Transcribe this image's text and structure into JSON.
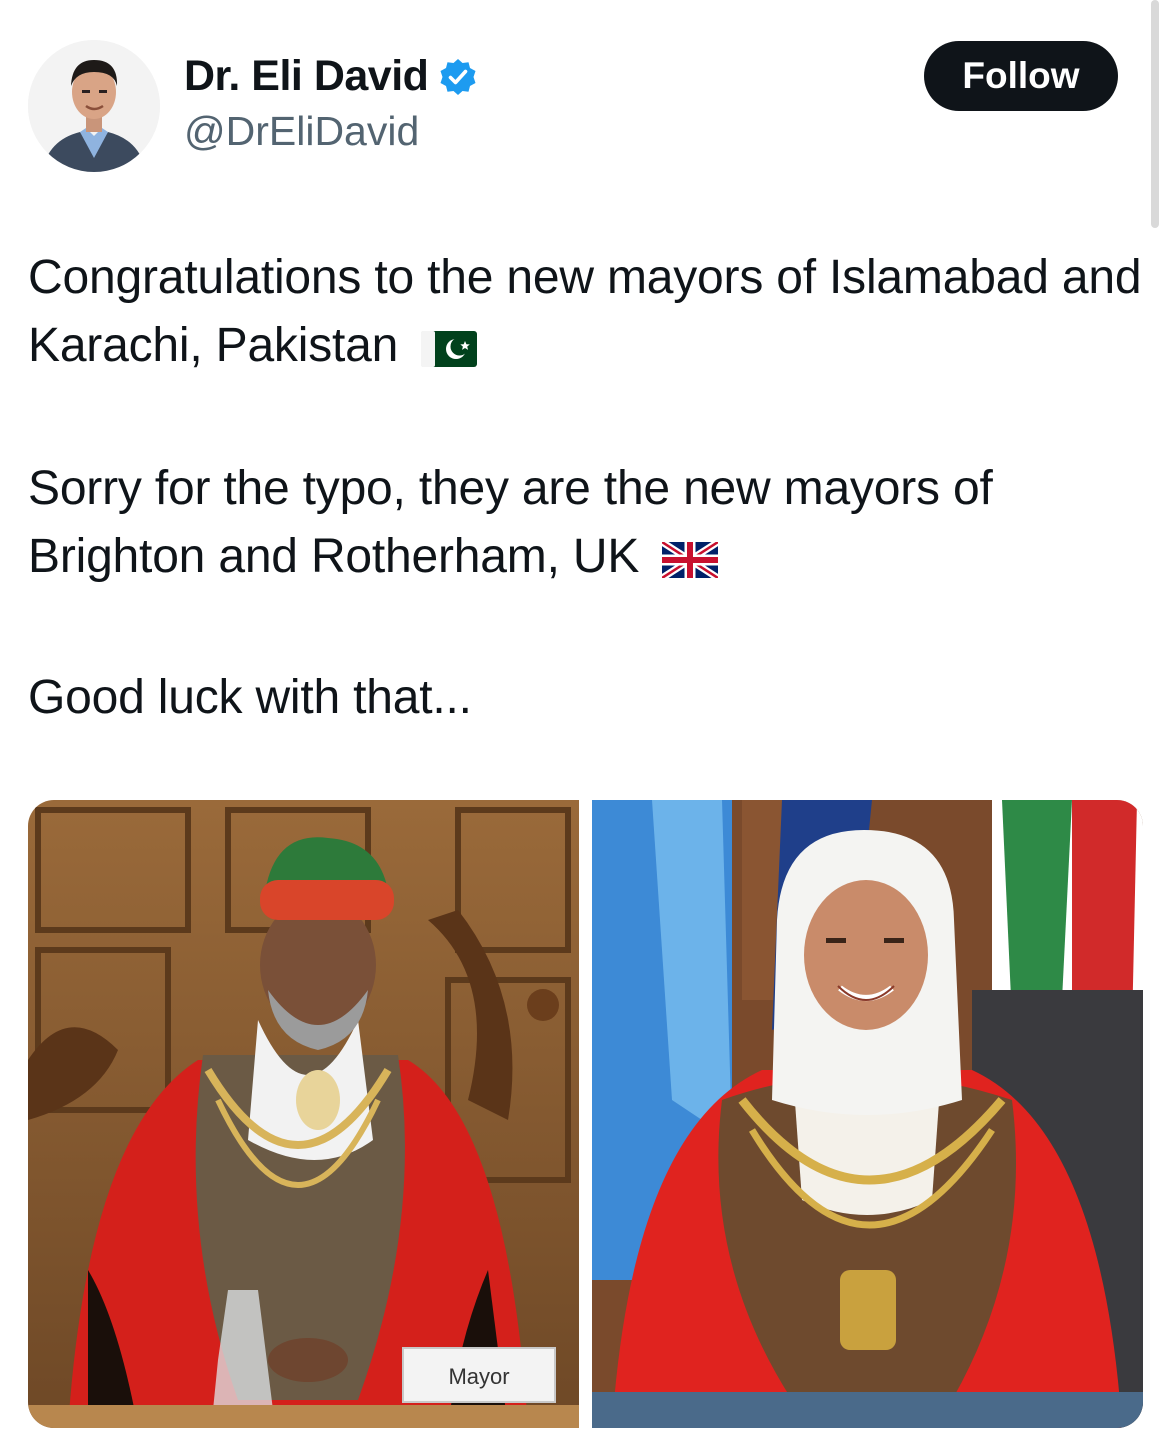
{
  "author": {
    "name": "Dr. Eli David",
    "handle": "@DrEliDavid",
    "verified": true
  },
  "follow_label": "Follow",
  "tweet": {
    "paragraph_1": "Congratulations to the new mayors of Islamabad and Karachi, Pakistan",
    "paragraph_1_flag": "pakistan-flag-icon",
    "paragraph_2": "Sorry for the typo, they are the new mayors of Brighton and Rotherham, UK",
    "paragraph_2_flag": "uk-flag-icon",
    "paragraph_3": "Good luck with that..."
  },
  "media": {
    "photo_1": {
      "nameplate": "Mayor"
    },
    "photo_2": {}
  },
  "colors": {
    "text": "#0f1419",
    "secondary": "#536471",
    "verified_blue": "#1d9bf0",
    "button": "#0f1419"
  }
}
